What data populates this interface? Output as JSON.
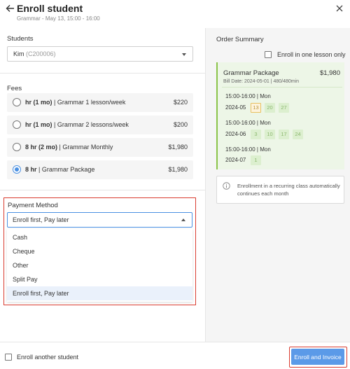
{
  "header": {
    "title": "Enroll student",
    "subtitle": "Grammar - May 13, 15:00 - 16:00"
  },
  "students": {
    "label": "Students",
    "selected_name": "Kim",
    "selected_code": "(C200006)"
  },
  "fees": {
    "label": "Fees",
    "items": [
      {
        "bold": "hr (1 mo)",
        "rest": " | Grammar 1 lesson/week",
        "price": "$220",
        "checked": false
      },
      {
        "bold": "hr (1 mo)",
        "rest": " | Grammar 2 lessons/week",
        "price": "$200",
        "checked": false
      },
      {
        "bold": "8 hr (2 mo)",
        "rest": " | Grammar Monthly",
        "price": "$1,980",
        "checked": false
      },
      {
        "bold": "8 hr",
        "rest": " | Grammar Package",
        "price": "$1,980",
        "checked": true
      }
    ]
  },
  "payment": {
    "label": "Payment Method",
    "selected": "Enroll first, Pay later",
    "options": [
      "Cash",
      "Cheque",
      "Other",
      "Split Pay",
      "Enroll first, Pay later"
    ]
  },
  "order_summary": {
    "title": "Order Summary",
    "one_lesson_label": "Enroll in one lesson only",
    "package": {
      "name": "Grammar Package",
      "price": "$1,980",
      "bill": "Bill Date: 2024-05-01 | 480/480min"
    },
    "schedule": [
      {
        "time": "15:00-16:00 | Mon",
        "month": "2024-05",
        "days": [
          "13",
          "20",
          "27"
        ],
        "highlight": "13"
      },
      {
        "time": "15:00-16:00 | Mon",
        "month": "2024-06",
        "days": [
          "3",
          "10",
          "17",
          "24"
        ],
        "highlight": ""
      },
      {
        "time": "15:00-16:00 | Mon",
        "month": "2024-07",
        "days": [
          "1"
        ],
        "highlight": ""
      }
    ],
    "info": "Enrollment in a recurring class automatically continues each month"
  },
  "footer": {
    "another_label": "Enroll another student",
    "enroll_button": "Enroll and Invoice"
  },
  "colors": {
    "accent": "#4a90e2",
    "button": "#5b9ae8",
    "highlight_border": "#d93c30",
    "package_green": "#8bc34a"
  }
}
